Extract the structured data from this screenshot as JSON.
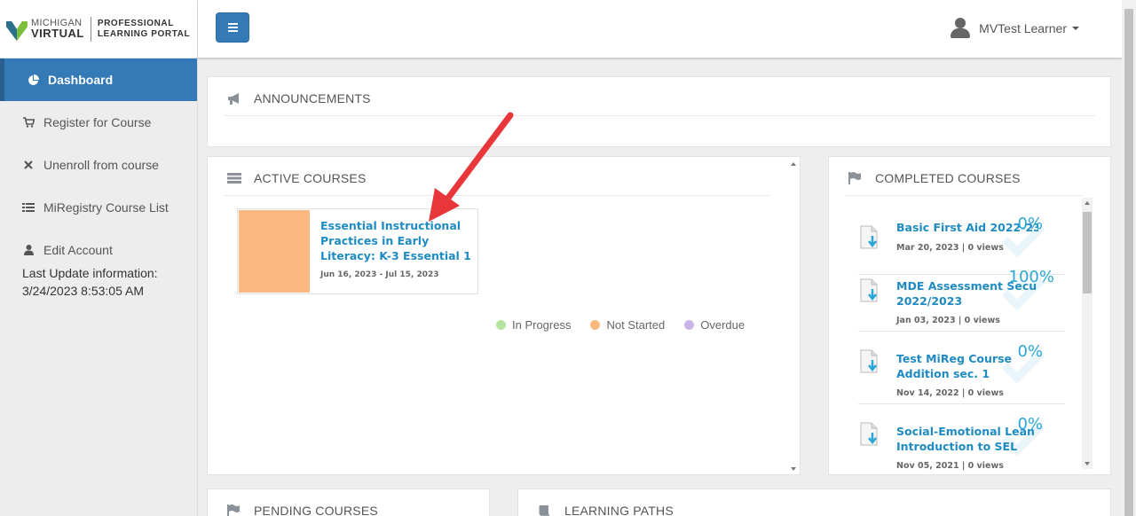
{
  "logo": {
    "line1": "MICHIGAN",
    "line2": "VIRTUAL",
    "portal_line1": "PROFESSIONAL",
    "portal_line2": "LEARNING PORTAL"
  },
  "sidebar": {
    "items": [
      {
        "label": "Dashboard",
        "icon": "pie-chart-icon",
        "active": true
      },
      {
        "label": "Register for Course",
        "icon": "cart-icon"
      },
      {
        "label": "Unenroll from course",
        "icon": "x-icon"
      },
      {
        "label": "MiRegistry Course List",
        "icon": "list-icon"
      },
      {
        "label": "Edit Account",
        "icon": "user-icon"
      }
    ],
    "last_update_label": "Last Update information:",
    "last_update_value": "3/24/2023 8:53:05 AM"
  },
  "header": {
    "user_name": "MVTest Learner"
  },
  "announcements": {
    "title": "ANNOUNCEMENTS"
  },
  "active_courses": {
    "title": "ACTIVE COURSES",
    "course": {
      "title": "Essential Instructional Practices in Early Literacy: K-3 Essential 1",
      "dates": "Jun 16, 2023 - Jul 15, 2023",
      "color": "#fbb881"
    },
    "legend": [
      {
        "label": "In Progress",
        "color": "#b5e3a0"
      },
      {
        "label": "Not Started",
        "color": "#fbb881"
      },
      {
        "label": "Overdue",
        "color": "#c9b5e8"
      }
    ]
  },
  "completed_courses": {
    "title": "COMPLETED COURSES",
    "items": [
      {
        "title": "Basic First Aid 2022-23",
        "meta": "Mar 20, 2023 | 0 views",
        "percent": "0%"
      },
      {
        "title_line1": "MDE Assessment Secu",
        "title_line2": "2022/2023",
        "meta": "Jan 03, 2023 | 0 views",
        "percent": "100%"
      },
      {
        "title_line1": "Test MiReg Course",
        "title_line2": "Addition sec. 1",
        "meta": "Nov 14, 2022 | 0 views",
        "percent": "0%"
      },
      {
        "title_line1": "Social-Emotional Lean",
        "title_line2": "Introduction to SEL",
        "meta": "Nov 05, 2021 | 0 views",
        "percent": "0%"
      }
    ]
  },
  "pending_courses": {
    "title": "PENDING COURSES"
  },
  "learning_paths": {
    "title": "LEARNING PATHS"
  },
  "colors": {
    "accent": "#337ab7",
    "link": "#1e8bc3",
    "arrow": "#e8363a"
  }
}
